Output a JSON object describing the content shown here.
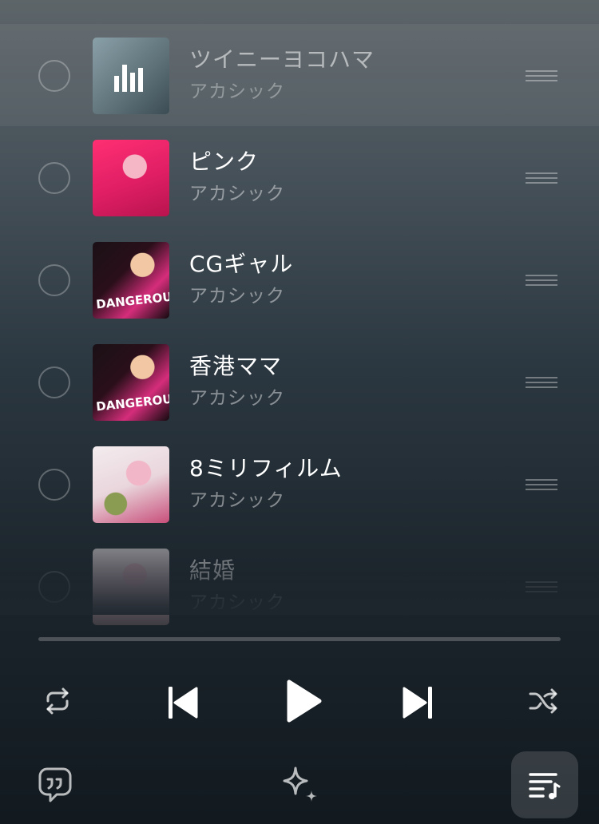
{
  "queue": {
    "items": [
      {
        "title": "ツイニーヨコハマ",
        "artist": "アカシック",
        "playing": true
      },
      {
        "title": "ピンク",
        "artist": "アカシック"
      },
      {
        "title": "CGギャル",
        "artist": "アカシック",
        "art_text": "DANGEROUS"
      },
      {
        "title": "香港ママ",
        "artist": "アカシック",
        "art_text": "DANGEROUS"
      },
      {
        "title": "8ミリフィルム",
        "artist": "アカシック"
      },
      {
        "title": "結婚",
        "artist": "アカシック"
      }
    ]
  },
  "controls": {
    "icons": [
      "repeat-icon",
      "previous-icon",
      "play-icon",
      "next-icon",
      "shuffle-icon",
      "lyrics-icon",
      "sparkle-icon",
      "queue-icon"
    ]
  },
  "colors": {
    "background_top": "#5d6569",
    "background_bottom": "#121a20",
    "text_primary": "#ffffff",
    "text_secondary": "#8a9094"
  }
}
